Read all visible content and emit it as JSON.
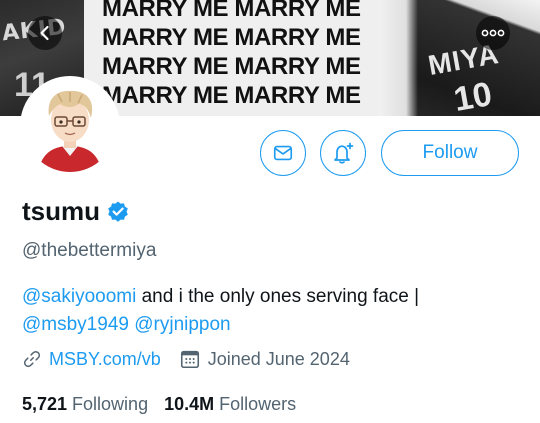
{
  "banner": {
    "text_lines": [
      "MARRY ME MARRY ME",
      "MARRY ME MARRY ME",
      "MARRY ME MARRY ME",
      "MARRY ME MARRY ME"
    ],
    "left_jersey_text": "AKID",
    "left_jersey_number": "11",
    "right_jersey_text": "MIYA",
    "right_jersey_number": "10"
  },
  "nav": {
    "back_icon": "chevron-left-icon",
    "more_icon": "more-horizontal-icon"
  },
  "actions": {
    "message_icon": "mail-icon",
    "notify_icon": "bell-plus-icon",
    "follow_label": "Follow"
  },
  "profile": {
    "display_name": "tsumu",
    "verified": true,
    "handle": "@thebettermiya",
    "bio": {
      "mention_1": "@sakiyooomi",
      "text_1": " and i the only ones serving face |",
      "mention_2": "@msby1949",
      "mention_3": "@ryjnippon"
    },
    "website": "MSBY.com/vb",
    "joined": "Joined June 2024"
  },
  "stats": {
    "following_count": "5,721",
    "following_label": "Following",
    "followers_count": "10.4M",
    "followers_label": "Followers"
  },
  "colors": {
    "accent": "#1d9bf0",
    "text_primary": "#0f1419",
    "text_secondary": "#536471"
  }
}
